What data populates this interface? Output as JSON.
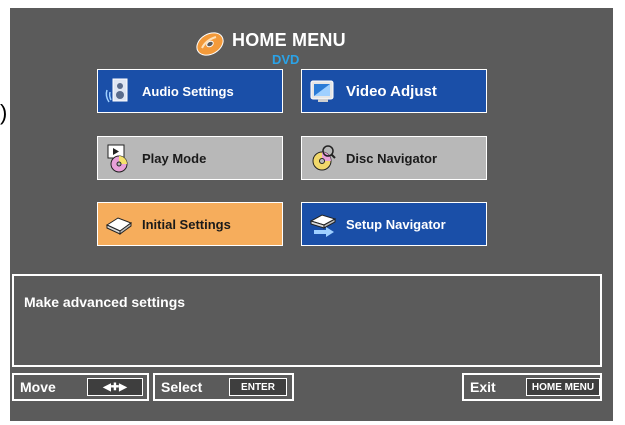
{
  "outside": {
    "paren": ")"
  },
  "header": {
    "title": "HOME MENU",
    "subtitle": "DVD",
    "logo_icon": "disc-icon"
  },
  "menu": {
    "items": [
      {
        "label": "Audio Settings",
        "icon": "speaker-icon",
        "state": "normal"
      },
      {
        "label": "Video Adjust",
        "icon": "tv-icon",
        "state": "normal"
      },
      {
        "label": "Play Mode",
        "icon": "play-mode-icon",
        "state": "disabled"
      },
      {
        "label": "Disc Navigator",
        "icon": "disc-navigator-icon",
        "state": "disabled"
      },
      {
        "label": "Initial Settings",
        "icon": "player-icon",
        "state": "selected"
      },
      {
        "label": "Setup Navigator",
        "icon": "setup-navigator-icon",
        "state": "normal"
      }
    ]
  },
  "description": {
    "text": "Make advanced settings"
  },
  "footer": {
    "move_label": "Move",
    "move_key": "◀✚▶",
    "select_label": "Select",
    "select_key": "ENTER",
    "exit_label": "Exit",
    "exit_key": "HOME MENU"
  },
  "colors": {
    "screen_bg": "#5b5b5b",
    "button_blue": "#1a4fa8",
    "button_gray": "#b8b8b8",
    "button_selected": "#f6ad5c",
    "subtitle_blue": "#2aa3e8"
  }
}
